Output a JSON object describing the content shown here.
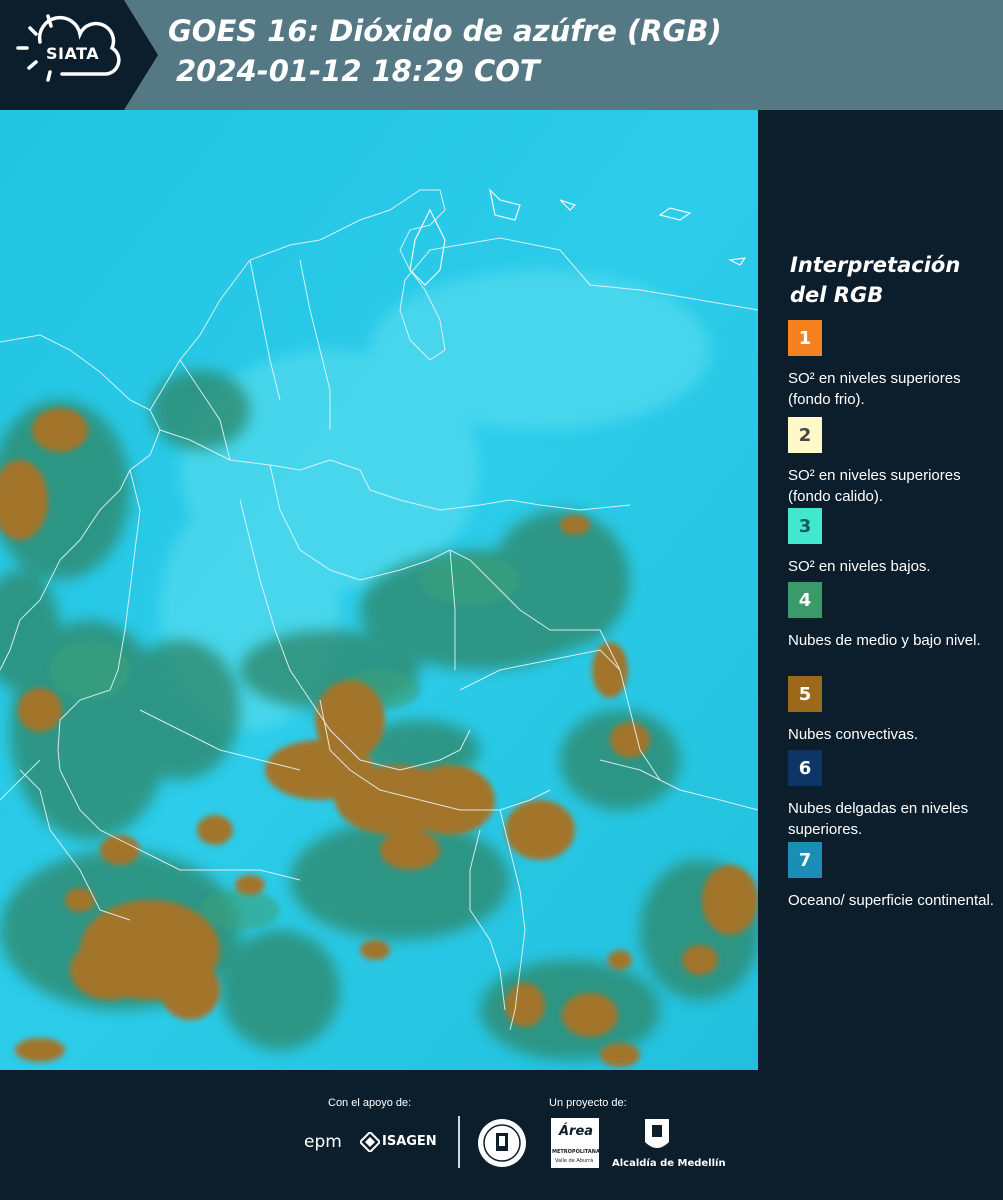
{
  "header": {
    "logo_text": "SIATA",
    "title_line1": "GOES 16: Dióxido de azúfre (RGB)",
    "title_line2": "2024-01-12 18:29 COT",
    "background_color": "#547985"
  },
  "map": {
    "icon": "satellite-map-image"
  },
  "legend": {
    "title": "Interpretación del RGB",
    "items": [
      {
        "number": "1",
        "color": "#f58220",
        "text_color": "#ffffff",
        "description": "SO² en niveles superiores (fondo frio)."
      },
      {
        "number": "2",
        "color": "#fff8c8",
        "text_color": "#444444",
        "description": "SO² en niveles superiores (fondo calido)."
      },
      {
        "number": "3",
        "color": "#3fe8cf",
        "text_color": "#1b5b55",
        "description": "SO² en niveles bajos."
      },
      {
        "number": "4",
        "color": "#3a9a6a",
        "text_color": "#ffffff",
        "description": "Nubes de medio y bajo nivel."
      },
      {
        "number": "5",
        "color": "#9a6a1a",
        "text_color": "#ffffff",
        "description": "Nubes convectivas."
      },
      {
        "number": "6",
        "color": "#0d3566",
        "text_color": "#ffffff",
        "description": "Nubes delgadas en niveles superiores."
      },
      {
        "number": "7",
        "color": "#1a8fb6",
        "text_color": "#ffffff",
        "description": "Oceano/ superficie continental."
      }
    ]
  },
  "footer": {
    "support_label": "Con el apoyo de:",
    "project_label": "Un proyecto de:",
    "logos": {
      "epm": "epm",
      "isagen": "ISAGEN",
      "area_top": "Área",
      "area_name": "METROPOLITANA",
      "area_sub": "Valle de Aburrá",
      "alcaldia": "Alcaldía de Medellín"
    }
  }
}
